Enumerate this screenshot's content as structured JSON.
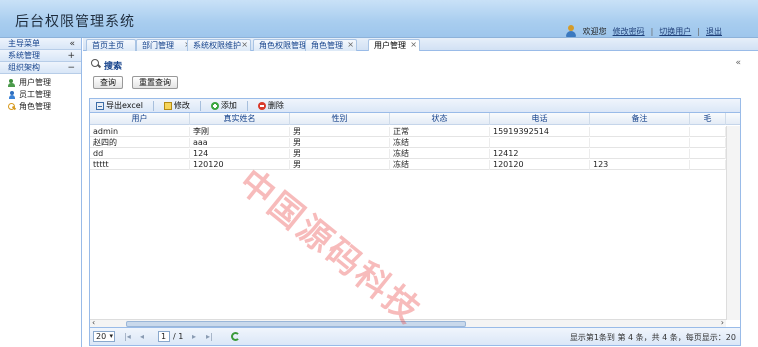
{
  "app": {
    "title": "后台权限管理系统"
  },
  "user_bar": {
    "welcome": "欢迎您",
    "links": [
      "修改密码",
      "切换用户",
      "退出"
    ]
  },
  "sidebar": {
    "sections": [
      {
        "label": "主导菜单",
        "tool": "«"
      },
      {
        "label": "系统管理",
        "tool": "+"
      },
      {
        "label": "组织架构",
        "tool": "−"
      }
    ],
    "items": [
      {
        "label": "用户管理",
        "icon": "users-icon"
      },
      {
        "label": "员工管理",
        "icon": "person-icon"
      },
      {
        "label": "角色管理",
        "icon": "key-icon"
      }
    ]
  },
  "tabs": [
    {
      "label": "首页主页"
    },
    {
      "label": "部门管理"
    },
    {
      "label": "系统权限维护"
    },
    {
      "label": "角色权限管理"
    },
    {
      "label": "角色管理"
    },
    {
      "label": "用户管理"
    }
  ],
  "search": {
    "title": "搜索",
    "query_button": "查询",
    "reset_button": "重置查询",
    "collapse_icon": "double-chevron-up-icon"
  },
  "toolbar": {
    "export_excel": "导出excel",
    "edit": "修改",
    "add": "添加",
    "delete": "删除"
  },
  "grid": {
    "columns": [
      "用户",
      "真实姓名",
      "性别",
      "状态",
      "电话",
      "备注",
      "毛"
    ],
    "rows": [
      [
        "admin",
        "李刚",
        "男",
        "正常",
        "15919392514",
        "",
        ""
      ],
      [
        "赵四的",
        "aaa",
        "男",
        "冻结",
        "",
        "",
        ""
      ],
      [
        "dd",
        "124",
        "男",
        "冻结",
        "12412",
        "",
        ""
      ],
      [
        "ttttt",
        "120120",
        "男",
        "冻结",
        "120120",
        "123",
        ""
      ]
    ]
  },
  "pager": {
    "page_size": "20",
    "current_page": "1",
    "total_pages": "/ 1",
    "info": "显示第1条到 第 4 条，共 4 条，每页显示：20"
  },
  "watermark": "中国源码科技",
  "colors": {
    "header_bg": "#a8cdef",
    "border": "#99bbe8",
    "link": "#1f3f78",
    "watermark": "#e83c3c"
  }
}
